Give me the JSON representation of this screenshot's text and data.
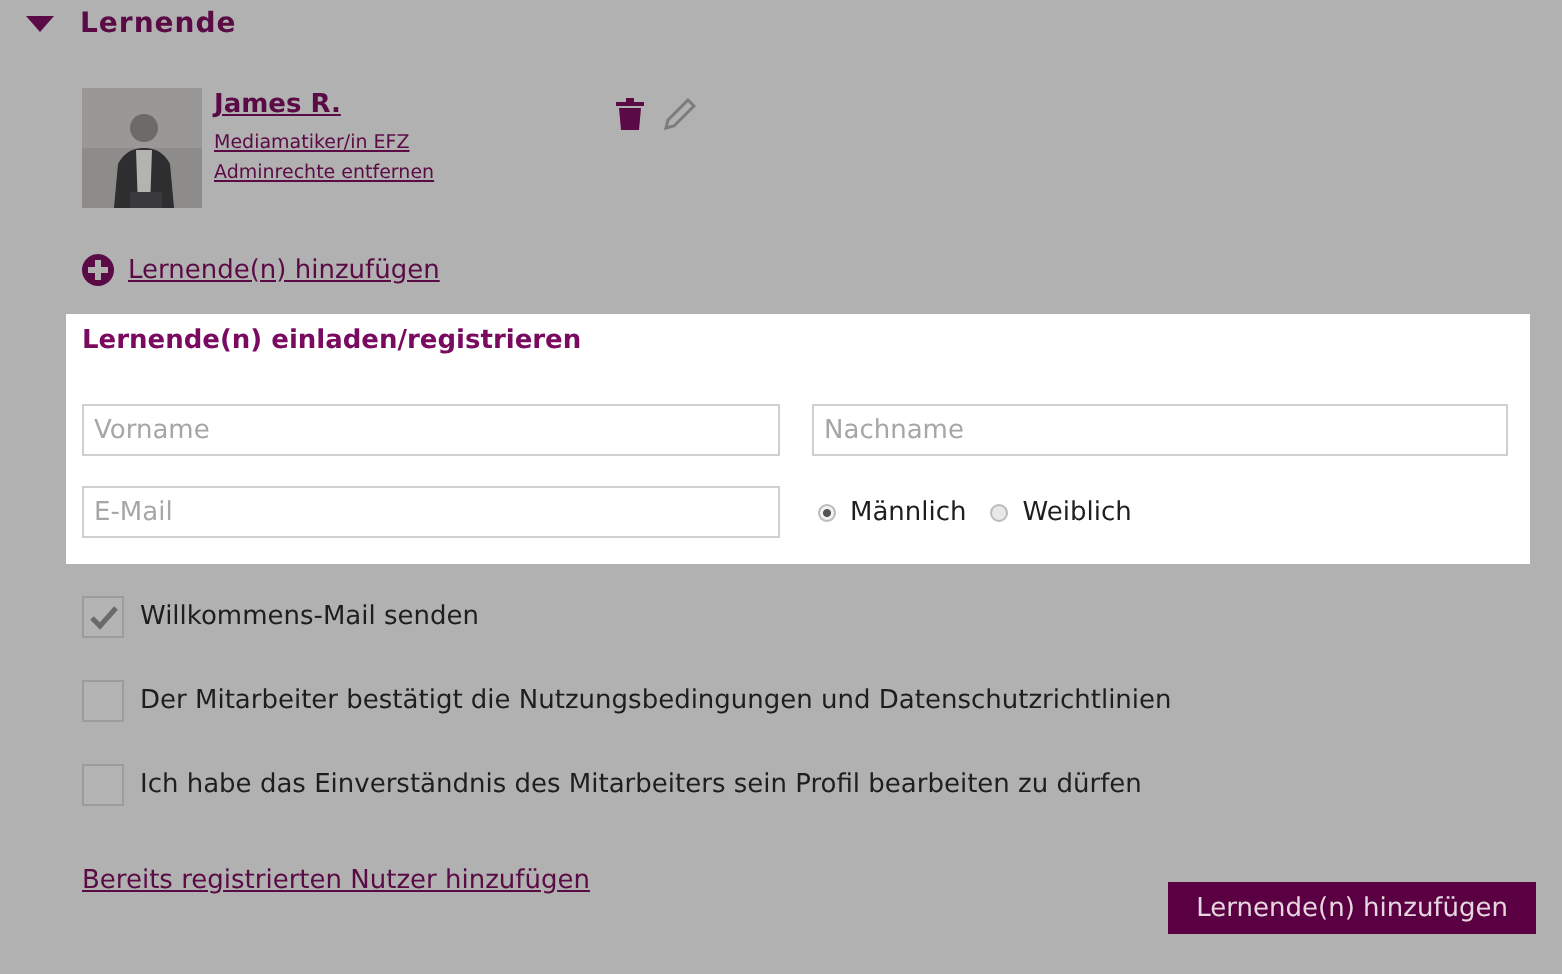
{
  "section": {
    "title": "Lernende",
    "expanded": true
  },
  "learner": {
    "name": "James R.",
    "role": "Mediamatiker/in EFZ",
    "action": "Adminrechte entfernen"
  },
  "add_link": "Lernende(n) hinzufügen",
  "invite": {
    "title": "Lernende(n) einladen/registrieren",
    "fields": [
      {
        "placeholder": "Vorname"
      },
      {
        "placeholder": "Nachname"
      },
      {
        "placeholder": "E-Mail"
      }
    ],
    "gender": [
      {
        "label": "Männlich",
        "selected": true
      },
      {
        "label": "Weiblich",
        "selected": false
      }
    ]
  },
  "checkboxes": [
    {
      "label": "Willkommens-Mail senden",
      "checked": true
    },
    {
      "label": "Der Mitarbeiter bestätigt die Nutzungsbedingungen und Datenschutzrichtlinien",
      "checked": false
    },
    {
      "label": "Ich habe das Einverständnis des Mitarbeiters sein Profil bearbeiten zu dürfen",
      "checked": false
    }
  ],
  "existing_link": "Bereits registrierten Nutzer hinzufügen",
  "submit_button": "Lernende(n) hinzufügen"
}
